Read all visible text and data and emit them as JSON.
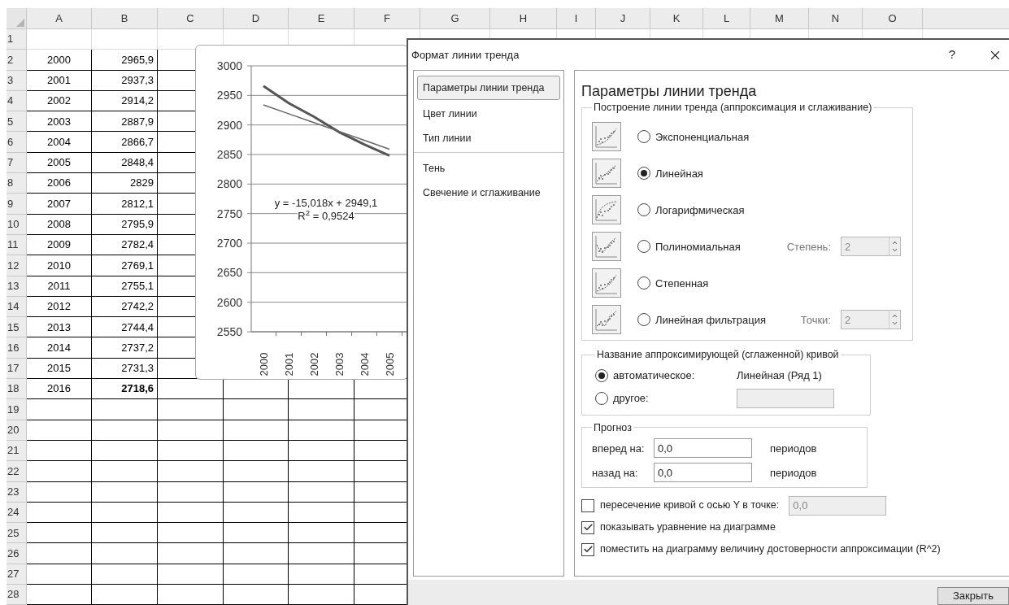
{
  "sheet": {
    "columns": [
      "A",
      "B",
      "C",
      "D",
      "E",
      "F",
      "G",
      "H",
      "I",
      "J",
      "K",
      "L",
      "M",
      "N",
      "O"
    ],
    "rows": [
      {
        "number": "1"
      },
      {
        "number": "2",
        "cells": [
          "2000",
          "2965,9"
        ],
        "bold": false
      },
      {
        "number": "3",
        "cells": [
          "2001",
          "2937,3"
        ],
        "bold": false
      },
      {
        "number": "4",
        "cells": [
          "2002",
          "2914,2"
        ],
        "bold": false
      },
      {
        "number": "5",
        "cells": [
          "2003",
          "2887,9"
        ],
        "bold": false
      },
      {
        "number": "6",
        "cells": [
          "2004",
          "2866,7"
        ],
        "bold": false
      },
      {
        "number": "7",
        "cells": [
          "2005",
          "2848,4"
        ],
        "bold": false
      },
      {
        "number": "8",
        "cells": [
          "2006",
          "2829"
        ],
        "bold": false
      },
      {
        "number": "9",
        "cells": [
          "2007",
          "2812,1"
        ],
        "bold": false
      },
      {
        "number": "10",
        "cells": [
          "2008",
          "2795,9"
        ],
        "bold": false
      },
      {
        "number": "11",
        "cells": [
          "2009",
          "2782,4"
        ],
        "bold": false
      },
      {
        "number": "12",
        "cells": [
          "2010",
          "2769,1"
        ],
        "bold": false
      },
      {
        "number": "13",
        "cells": [
          "2011",
          "2755,1"
        ],
        "bold": false
      },
      {
        "number": "14",
        "cells": [
          "2012",
          "2742,2"
        ],
        "bold": false
      },
      {
        "number": "15",
        "cells": [
          "2013",
          "2744,4"
        ],
        "bold": false
      },
      {
        "number": "16",
        "cells": [
          "2014",
          "2737,2"
        ],
        "bold": false
      },
      {
        "number": "17",
        "cells": [
          "2015",
          "2731,3"
        ],
        "bold": false
      },
      {
        "number": "18",
        "cells": [
          "2016",
          "2718,6"
        ],
        "bold": true
      },
      {
        "number": "19"
      },
      {
        "number": "20"
      },
      {
        "number": "21"
      },
      {
        "number": "22"
      },
      {
        "number": "23"
      },
      {
        "number": "24"
      },
      {
        "number": "25"
      },
      {
        "number": "26"
      },
      {
        "number": "27"
      },
      {
        "number": "28"
      }
    ]
  },
  "chart": {
    "chart_data": {
      "type": "line",
      "categories": [
        "2000",
        "2001",
        "2002",
        "2003",
        "2004",
        "2005"
      ],
      "ylim": [
        2550,
        3000
      ],
      "yticks": [
        2550,
        2600,
        2650,
        2700,
        2750,
        2800,
        2850,
        2900,
        2950,
        3000
      ],
      "series": [
        {
          "color": "#555555",
          "values": [
            2966,
            2937,
            2914,
            2888,
            2867,
            2848
          ]
        },
        {
          "color": "#666666",
          "values": [
            2934,
            2919,
            2904,
            2889,
            2874,
            2859
          ]
        }
      ],
      "grid": true,
      "annotations": [
        "y = -15,018x + 2949,1",
        "R$^{2}$ = 0,9524"
      ]
    }
  },
  "dialog": {
    "title": "Формат линии тренда",
    "help": "?",
    "nav_groups": [
      {
        "items": [
          {
            "label": "Параметры линии тренда",
            "selected": true
          },
          {
            "label": "Цвет линии",
            "selected": false
          },
          {
            "label": "Тип линии",
            "selected": false
          }
        ]
      },
      {
        "items": [
          {
            "label": "Тень",
            "selected": false
          },
          {
            "label": "Свечение и сглаживание",
            "selected": false
          }
        ]
      }
    ],
    "heading": "Параметры линии тренда",
    "trend_group": {
      "title": "Построение линии тренда (аппроксимация и сглаживание)",
      "options": [
        {
          "kind": "exponential",
          "label": "Экспоненциальная",
          "selected": false
        },
        {
          "kind": "linear",
          "label": "Линейная",
          "selected": true
        },
        {
          "kind": "logarithmic",
          "label": "Логарифмическая",
          "selected": false
        },
        {
          "kind": "polynomial",
          "label": "Полиномиальная",
          "selected": false,
          "spinner": {
            "label": "Степень:",
            "value": "2",
            "disabled": true
          }
        },
        {
          "kind": "power",
          "label": "Степенная",
          "selected": false
        },
        {
          "kind": "moving_average",
          "label": "Линейная фильтрация",
          "selected": false,
          "spinner": {
            "label": "Точки:",
            "value": "2",
            "disabled": true
          }
        }
      ]
    },
    "name_group": {
      "title": "Название аппроксимирующей (сглаженной) кривой",
      "options": [
        {
          "label": "автоматическое:",
          "selected": true,
          "value": "Линейная (Ряд 1)"
        },
        {
          "label": "другое:",
          "selected": false,
          "field": {
            "disabled": true
          }
        }
      ]
    },
    "forecast": {
      "title": "Прогноз",
      "rows": [
        {
          "label": "вперед на:",
          "value": "0,0",
          "unit": "периодов"
        },
        {
          "label": "назад на:",
          "value": "0,0",
          "unit": "периодов"
        }
      ]
    },
    "checks": [
      {
        "label": "пересечение кривой с осью Y в точке:",
        "checked": false,
        "field": {
          "value": "0,0",
          "disabled": true
        }
      },
      {
        "label": "показывать уравнение на диаграмме",
        "checked": true
      },
      {
        "label": "поместить на диаграмму величину достоверности аппроксимации (R^2)",
        "checked": true
      }
    ],
    "close_button": "Закрыть"
  }
}
